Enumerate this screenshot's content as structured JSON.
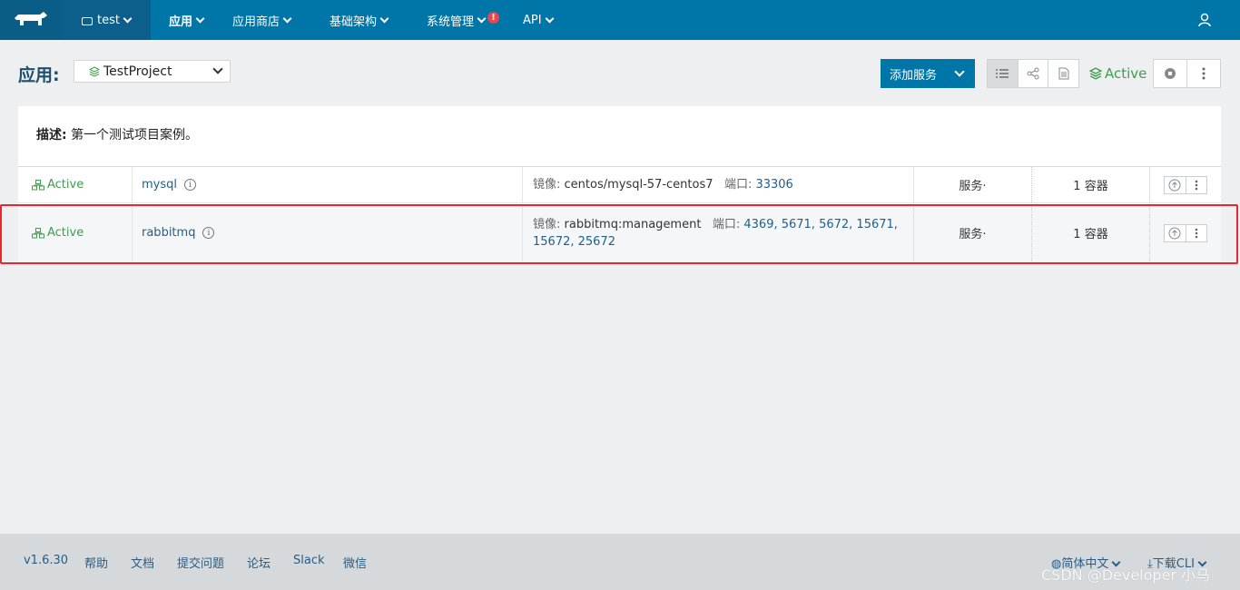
{
  "nav": {
    "environment": "test",
    "items": [
      "应用",
      "应用商店",
      "基础架构",
      "系统管理",
      "API"
    ],
    "alert_badge": "!"
  },
  "header": {
    "title": "应用:",
    "project": "TestProject",
    "add_service": "添加服务",
    "state": "Active"
  },
  "panel": {
    "desc_label": "描述:",
    "desc_text": "第一个测试项目案例。"
  },
  "services": [
    {
      "state": "Active",
      "name": "mysql",
      "image_label": "镜像:",
      "image": "centos/mysql-57-centos7",
      "port_label": "端口:",
      "ports": "33306",
      "ports_line2": "",
      "kind": "服务·",
      "containers": "1 容器"
    },
    {
      "state": "Active",
      "name": "rabbitmq",
      "image_label": "镜像:",
      "image": "rabbitmq:management",
      "port_label": "端口:",
      "ports": "4369, 5671, 5672, 15671,",
      "ports_line2": "15672, 25672",
      "kind": "服务·",
      "containers": "1 容器"
    }
  ],
  "footer": {
    "version": "v1.6.30",
    "links": [
      "帮助",
      "文档",
      "提交问题",
      "论坛",
      "Slack",
      "微信"
    ],
    "language": "简体中文",
    "download": "下载CLI"
  },
  "watermark": "CSDN @Developer 小马",
  "colors": {
    "nav_bg": "#0075a8",
    "active_green": "#3e9e4f",
    "highlight_red": "#e8262b"
  }
}
